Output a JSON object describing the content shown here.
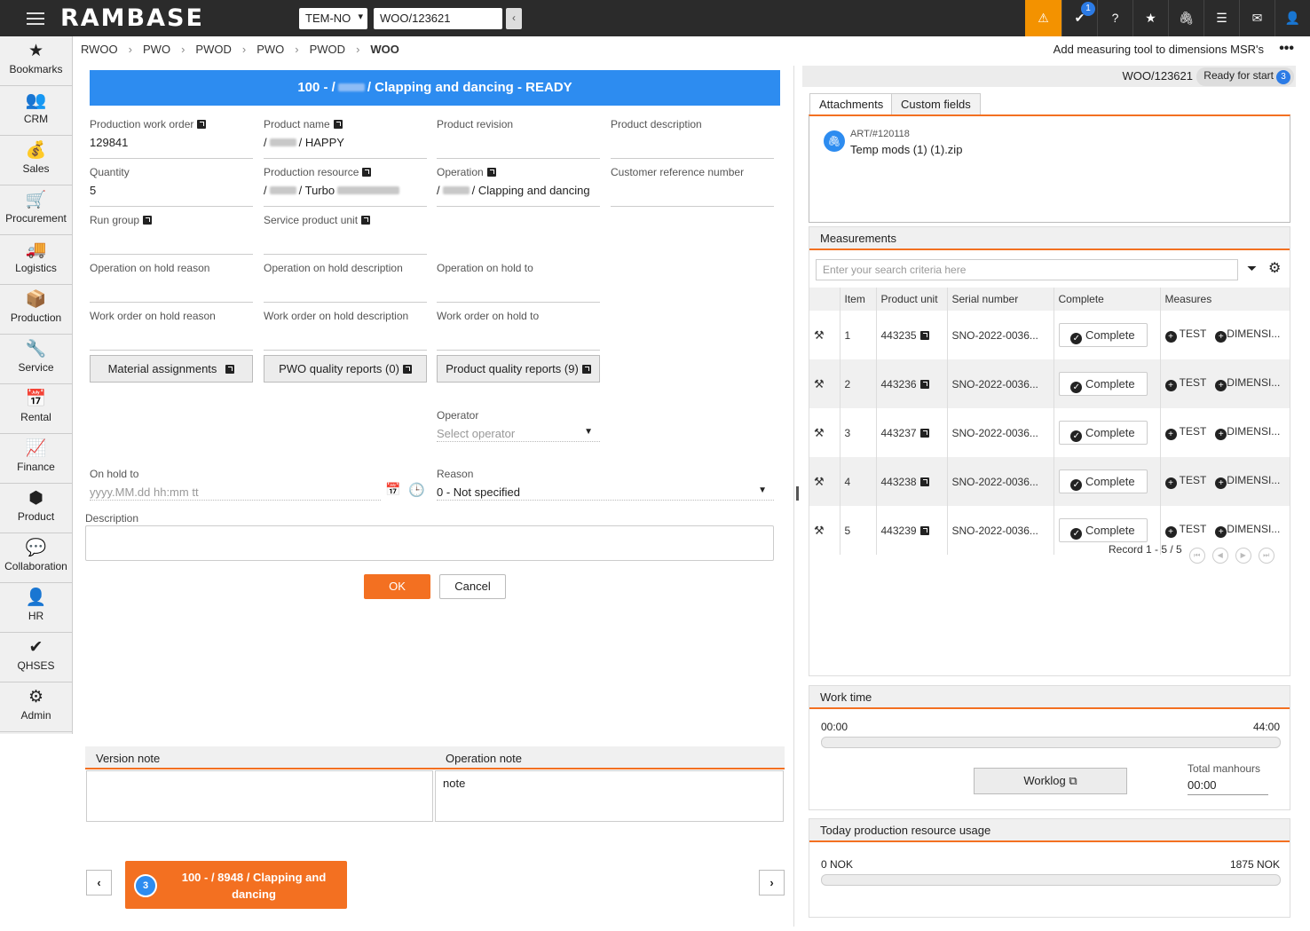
{
  "header": {
    "logo": "RAMBASE",
    "company": "TEM-NO",
    "doc_id": "WOO/123621",
    "notification_count": "1"
  },
  "icons": {
    "menu": "hamburger-icon",
    "warning": "warning-icon",
    "tasks": "task-check-icon",
    "help": "help-icon",
    "favorite": "star-icon",
    "attach": "paperclip-icon",
    "list": "list-icon",
    "mail": "mail-icon",
    "user": "user-icon"
  },
  "sidebar": {
    "items": [
      {
        "label": "Bookmarks",
        "icon": "star-icon",
        "glyph": "★"
      },
      {
        "label": "CRM",
        "icon": "people-icon",
        "glyph": "👥"
      },
      {
        "label": "Sales",
        "icon": "money-bag-icon",
        "glyph": "💰"
      },
      {
        "label": "Procurement",
        "icon": "cart-icon",
        "glyph": "🛒"
      },
      {
        "label": "Logistics",
        "icon": "truck-icon",
        "glyph": "🚚"
      },
      {
        "label": "Production",
        "icon": "boxes-icon",
        "glyph": "📦"
      },
      {
        "label": "Service",
        "icon": "wrench-icon",
        "glyph": "🔧"
      },
      {
        "label": "Rental",
        "icon": "calendar-money-icon",
        "glyph": "📅"
      },
      {
        "label": "Finance",
        "icon": "trend-line-icon",
        "glyph": "📈"
      },
      {
        "label": "Product",
        "icon": "cube-icon",
        "glyph": "⬢"
      },
      {
        "label": "Collaboration",
        "icon": "chat-icon",
        "glyph": "💬"
      },
      {
        "label": "HR",
        "icon": "person-icon",
        "glyph": "👤"
      },
      {
        "label": "QHSES",
        "icon": "shield-check-icon",
        "glyph": "✔"
      },
      {
        "label": "Admin",
        "icon": "gear-icon",
        "glyph": "⚙"
      }
    ]
  },
  "breadcrumb": [
    "RWOO",
    "PWO",
    "PWOD",
    "PWO",
    "PWOD",
    "WOO"
  ],
  "top_task": "Add measuring tool to dimensions MSR's",
  "title": {
    "prefix": "100 - /",
    "suffix": "/ Clapping and dancing - READY"
  },
  "fields": {
    "pwo_label": "Production work order",
    "pwo_value": "129841",
    "pname_label": "Product name",
    "pname_pre": "/",
    "pname_value": "/ HAPPY",
    "prev_label": "Product revision",
    "pdesc_label": "Product description",
    "qty_label": "Quantity",
    "qty_value": "5",
    "pres_label": "Production resource",
    "pres_pre": "/",
    "pres_value": "/ Turbo",
    "op_label": "Operation",
    "op_pre": "/",
    "op_value": "/ Clapping and dancing",
    "custref_label": "Customer reference number",
    "rungroup_label": "Run group",
    "spu_label": "Service product unit",
    "ohr_label": "Operation on hold reason",
    "ohd_label": "Operation on hold description",
    "oht_label": "Operation on hold to",
    "wohr_label": "Work order on hold reason",
    "wohd_label": "Work order on hold description",
    "woht_label": "Work order on hold to"
  },
  "buttons": {
    "material": "Material assignments",
    "pwo_quality": "PWO quality reports (0)",
    "prod_quality": "Product quality reports (9)",
    "ok": "OK",
    "cancel": "Cancel"
  },
  "form": {
    "operator_label": "Operator",
    "operator_placeholder": "Select operator",
    "onhold_label": "On hold to",
    "onhold_placeholder": "yyyy.MM.dd hh:mm tt",
    "reason_label": "Reason",
    "reason_value": "0 - Not specified",
    "desc_label": "Description"
  },
  "notes": {
    "version_label": "Version note",
    "operation_label": "Operation note",
    "operation_text": "note"
  },
  "operation_card": {
    "count": "3",
    "text": "100 - / 8948 / Clapping and dancing"
  },
  "right": {
    "doc_id": "WOO/123621",
    "status": "Ready for start",
    "status_count": "3",
    "tabs": [
      "Attachments",
      "Custom fields"
    ],
    "attachment_ref": "ART/#120118",
    "attachment_name": "Temp mods (1) (1).zip"
  },
  "measurements": {
    "title": "Measurements",
    "search_placeholder": "Enter your search criteria here",
    "columns": [
      "Item",
      "Product unit",
      "Serial number",
      "Complete",
      "Measures"
    ],
    "rows": [
      {
        "item": "1",
        "unit": "443235",
        "serial": "SNO-2022-0036...",
        "complete": "Complete",
        "m1": "TEST",
        "m2": "DIMENSI..."
      },
      {
        "item": "2",
        "unit": "443236",
        "serial": "SNO-2022-0036...",
        "complete": "Complete",
        "m1": "TEST",
        "m2": "DIMENSI..."
      },
      {
        "item": "3",
        "unit": "443237",
        "serial": "SNO-2022-0036...",
        "complete": "Complete",
        "m1": "TEST",
        "m2": "DIMENSI..."
      },
      {
        "item": "4",
        "unit": "443238",
        "serial": "SNO-2022-0036...",
        "complete": "Complete",
        "m1": "TEST",
        "m2": "DIMENSI..."
      },
      {
        "item": "5",
        "unit": "443239",
        "serial": "SNO-2022-0036...",
        "complete": "Complete",
        "m1": "TEST",
        "m2": "DIMENSI..."
      }
    ],
    "pager": "Record 1 - 5 / 5"
  },
  "worktime": {
    "title": "Work time",
    "start": "00:00",
    "end": "44:00",
    "progress": 0,
    "worklog_label": "Worklog",
    "manhours_label": "Total manhours",
    "manhours_value": "00:00"
  },
  "usage": {
    "title": "Today production resource usage",
    "min": "0 NOK",
    "max": "1875 NOK",
    "progress": 0
  },
  "colors": {
    "accent": "#f37021",
    "primary": "#2d8cf0",
    "warning": "#f39200",
    "topbar": "#2b2b2b"
  }
}
